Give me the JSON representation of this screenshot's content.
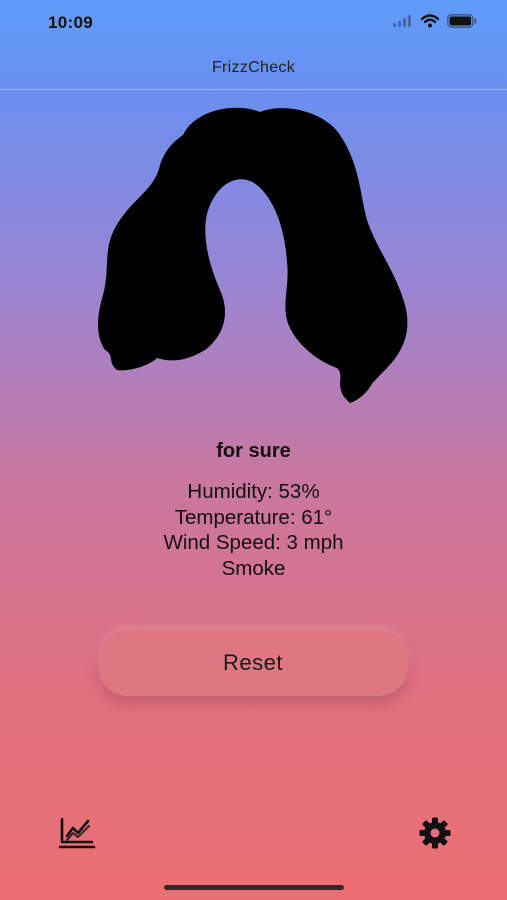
{
  "status_bar": {
    "time": "10:09"
  },
  "nav": {
    "title": "FrizzCheck"
  },
  "result": {
    "verdict": "for sure",
    "humidity": "Humidity: 53%",
    "temperature": "Temperature: 61°",
    "wind": "Wind Speed: 3 mph",
    "condition": "Smoke"
  },
  "actions": {
    "reset_label": "Reset"
  },
  "tabs": [
    {
      "icon": "chart-icon"
    },
    {
      "icon": "gear-icon"
    }
  ],
  "colors": {
    "gradient_top": "#5f9cfa",
    "gradient_bottom": "#ea6f72",
    "button": "#df7782"
  }
}
